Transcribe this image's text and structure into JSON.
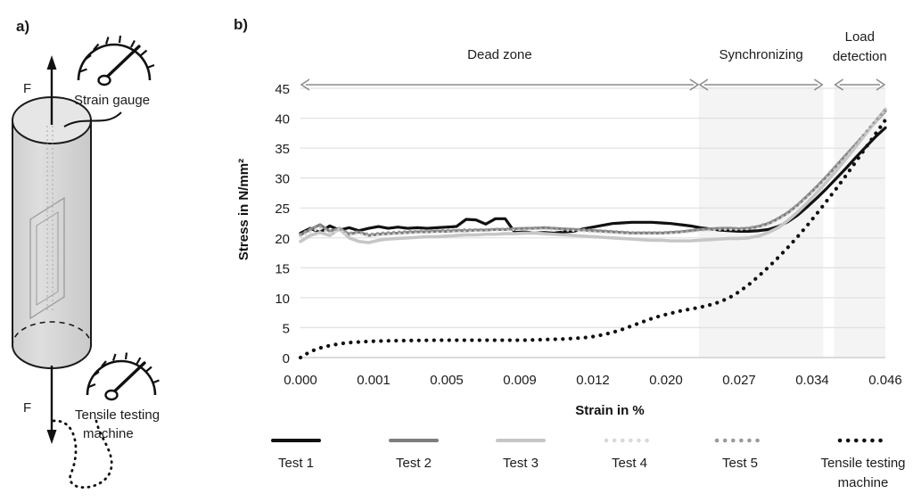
{
  "panels": {
    "a_label": "a)",
    "b_label": "b)"
  },
  "diagram": {
    "force_top_label": "F",
    "force_bottom_label": "F",
    "strain_gauge_label": "Strain gauge",
    "machine_label_line1": "Tensile testing",
    "machine_label_line2": "machine",
    "icons": {
      "gauge_top": "gauge-icon",
      "gauge_bottom": "gauge-icon"
    }
  },
  "chart_data": {
    "type": "line",
    "title": "",
    "xlabel": "Strain in %",
    "ylabel": "Stress in N/mm²",
    "x_tick_labels": [
      "0.000",
      "0.001",
      "0.005",
      "0.009",
      "0.012",
      "0.020",
      "0.027",
      "0.034",
      "0.046"
    ],
    "y_tick_labels": [
      "0",
      "5",
      "10",
      "15",
      "20",
      "25",
      "30",
      "35",
      "40",
      "45"
    ],
    "ylim": [
      0,
      45
    ],
    "grid": true,
    "legend_position": "bottom",
    "zones": [
      {
        "name": "Dead zone",
        "start_index": 0.0,
        "end_index": 5.45,
        "shaded": false
      },
      {
        "name": "Synchronizing",
        "start_index": 5.45,
        "end_index": 7.15,
        "shaded": true
      },
      {
        "name": "Load detection",
        "start_index": 7.3,
        "end_index": 8.0,
        "shaded": true
      }
    ],
    "series": [
      {
        "name": "Test 1",
        "color": "#111111",
        "style": "solid",
        "width": 3.2,
        "values": [
          20.8,
          21.6,
          20.9,
          22.0,
          21.3,
          21.7,
          21.2,
          21.6,
          21.9,
          21.6,
          21.8,
          21.6,
          21.7,
          21.6,
          21.7,
          21.8,
          21.9,
          23.1,
          23.0,
          22.3,
          23.2,
          23.2,
          20.9,
          21.0,
          20.8,
          20.9,
          20.8,
          21.0,
          21.1,
          21.5,
          21.8,
          22.1,
          22.4,
          22.5,
          22.6,
          22.6,
          22.6,
          22.5,
          22.4,
          22.2,
          22.0,
          21.7,
          21.5,
          21.3,
          21.2,
          21.1,
          21.1,
          21.2,
          21.4,
          21.9,
          22.7,
          23.8,
          25.2,
          26.7,
          28.3,
          30.0,
          31.7,
          33.5,
          35.2,
          36.9,
          38.4
        ]
      },
      {
        "name": "Test 2",
        "color": "#7d7d7d",
        "style": "solid",
        "width": 3.2,
        "values": [
          20.5,
          21.4,
          22.2,
          21.1,
          21.6,
          20.6,
          21.0,
          20.4,
          20.6,
          20.7,
          20.8,
          20.9,
          21.0,
          21.0,
          21.1,
          21.1,
          21.2,
          21.2,
          21.3,
          21.3,
          21.4,
          21.4,
          21.5,
          21.6,
          21.6,
          21.7,
          21.6,
          21.5,
          21.4,
          21.3,
          21.2,
          21.1,
          21.0,
          20.9,
          20.8,
          20.8,
          20.8,
          20.8,
          20.9,
          21.0,
          21.2,
          21.4,
          21.5,
          21.6,
          21.6,
          21.5,
          21.6,
          21.9,
          22.4,
          23.2,
          24.2,
          25.5,
          27.0,
          28.6,
          30.3,
          32.1,
          33.9,
          35.7,
          37.5,
          39.4,
          41.2
        ]
      },
      {
        "name": "Test 3",
        "color": "#c6c6c6",
        "style": "solid",
        "width": 3.6,
        "values": [
          19.4,
          20.4,
          20.9,
          20.4,
          21.5,
          20.0,
          19.4,
          19.2,
          19.6,
          19.8,
          19.9,
          20.0,
          20.1,
          20.2,
          20.2,
          20.3,
          20.4,
          20.5,
          20.5,
          20.6,
          20.6,
          20.7,
          20.7,
          20.8,
          20.8,
          20.7,
          20.6,
          20.5,
          20.4,
          20.3,
          20.2,
          20.1,
          20.0,
          19.9,
          19.8,
          19.7,
          19.6,
          19.6,
          19.5,
          19.5,
          19.5,
          19.6,
          19.7,
          19.8,
          19.9,
          19.9,
          20.0,
          20.3,
          20.9,
          21.7,
          22.9,
          24.3,
          25.9,
          27.6,
          29.4,
          31.3,
          33.3,
          35.3,
          37.4,
          39.5,
          41.5
        ]
      },
      {
        "name": "Test 4",
        "color": "#d9d9d9",
        "style": "dotted",
        "width": 3.0,
        "values": [
          20.2,
          21.0,
          21.6,
          20.8,
          21.2,
          20.5,
          20.7,
          20.3,
          20.5,
          20.6,
          20.7,
          20.8,
          20.9,
          21.0,
          21.0,
          21.1,
          21.1,
          21.2,
          21.2,
          21.3,
          21.3,
          21.3,
          21.4,
          21.4,
          21.5,
          21.5,
          21.4,
          21.3,
          21.2,
          21.1,
          21.0,
          20.9,
          20.8,
          20.8,
          20.7,
          20.7,
          20.7,
          20.7,
          20.8,
          20.9,
          21.0,
          21.2,
          21.3,
          21.4,
          21.4,
          21.4,
          21.5,
          21.8,
          22.3,
          23.1,
          24.1,
          25.4,
          26.9,
          28.5,
          30.2,
          32.0,
          33.8,
          35.7,
          37.6,
          39.5,
          41.3
        ]
      },
      {
        "name": "Test 5",
        "color": "#9a9a9a",
        "style": "dotted",
        "width": 3.0,
        "values": [
          20.6,
          21.5,
          22.0,
          21.2,
          21.5,
          20.8,
          21.1,
          20.6,
          20.8,
          20.9,
          21.0,
          21.1,
          21.1,
          21.2,
          21.2,
          21.3,
          21.3,
          21.4,
          21.4,
          21.4,
          21.5,
          21.5,
          21.6,
          21.6,
          21.7,
          21.7,
          21.6,
          21.5,
          21.5,
          21.4,
          21.3,
          21.2,
          21.1,
          21.0,
          20.9,
          20.9,
          20.9,
          20.9,
          21.0,
          21.1,
          21.2,
          21.4,
          21.5,
          21.6,
          21.7,
          21.6,
          21.7,
          22.0,
          22.5,
          23.3,
          24.3,
          25.6,
          27.1,
          28.7,
          30.4,
          32.2,
          34.0,
          35.8,
          37.7,
          39.6,
          41.4
        ]
      },
      {
        "name": "Tensile testing machine",
        "color": "#111111",
        "style": "dotted",
        "width": 4.2,
        "values": [
          0.0,
          1.0,
          1.6,
          2.0,
          2.3,
          2.5,
          2.6,
          2.7,
          2.75,
          2.8,
          2.82,
          2.84,
          2.86,
          2.88,
          2.9,
          2.9,
          2.9,
          2.9,
          2.9,
          2.9,
          2.9,
          2.9,
          2.9,
          2.9,
          2.95,
          3.0,
          3.05,
          3.1,
          3.2,
          3.3,
          3.5,
          3.8,
          4.2,
          4.7,
          5.3,
          5.9,
          6.5,
          7.0,
          7.4,
          7.8,
          8.1,
          8.4,
          8.8,
          9.3,
          10.0,
          11.0,
          12.2,
          13.6,
          15.1,
          16.7,
          18.4,
          20.2,
          22.1,
          24.1,
          26.2,
          28.3,
          30.5,
          32.8,
          35.1,
          37.4,
          39.7
        ]
      }
    ],
    "legend": [
      {
        "label": "Test 1",
        "color": "#111111",
        "style": "solid"
      },
      {
        "label": "Test 2",
        "color": "#7d7d7d",
        "style": "solid"
      },
      {
        "label": "Test 3",
        "color": "#c6c6c6",
        "style": "solid"
      },
      {
        "label": "Test 4",
        "color": "#d9d9d9",
        "style": "dotted"
      },
      {
        "label": "Test 5",
        "color": "#9a9a9a",
        "style": "dotted"
      },
      {
        "label": "Tensile testing machine",
        "color": "#111111",
        "style": "dotted"
      }
    ]
  },
  "colors": {
    "grid": "#e2e2e2",
    "zone_shade": "#f5f4f4",
    "arrow": "#8a8a8a",
    "text": "#1c1c1c"
  }
}
